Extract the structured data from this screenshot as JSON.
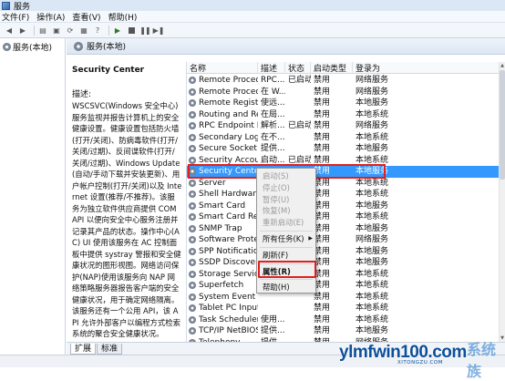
{
  "window": {
    "title": "服务"
  },
  "menubar": {
    "items": [
      "文件(F)",
      "操作(A)",
      "查看(V)",
      "帮助(H)"
    ]
  },
  "tree": {
    "root_label": "服务(本地)"
  },
  "main_header": {
    "title": "服务(本地)"
  },
  "description": {
    "service_name": "Security Center",
    "label": "描述:",
    "text": "WSCSVC(Windows 安全中心)服务监视并报告计算机上的安全健康设置。健康设置包括防火墙(打开/关闭)、防病毒软件(打开/关闭/过期)、反间谍软件(打开/关闭/过期)、Windows Update(自动/手动下载并安装更新)、用户帐户控制(打开/关闭)以及 Internet 设置(推荐/不推荐)。该服务为独立软件供应商提供 COM API 以便向安全中心服务注册并记录其产品的状态。操作中心(AC) UI 使用该服务在 AC 控制面板中提供 systray 警报和安全健康状况的图形视图。网络访问保护(NAP)使用该服务向 NAP 网络策略服务器报告客户端的安全健康状况，用于确定网络隔离。该服务还有一个公用 API，该 API 允许外部客户以编程方式检索系统的聚合安全健康状况。"
  },
  "list": {
    "columns": [
      "名称",
      "描述",
      "状态",
      "启动类型",
      "登录为"
    ],
    "rows": [
      {
        "name": "Remote Procedu...",
        "desc": "RPC...",
        "status": "已启动",
        "startup": "禁用",
        "logon": "网络服务"
      },
      {
        "name": "Remote Procedu...",
        "desc": "在 W...",
        "status": "",
        "startup": "禁用",
        "logon": "网络服务"
      },
      {
        "name": "Remote Registry",
        "desc": "使远...",
        "status": "",
        "startup": "禁用",
        "logon": "本地服务"
      },
      {
        "name": "Routing and Re...",
        "desc": "在局...",
        "status": "",
        "startup": "禁用",
        "logon": "本地系统"
      },
      {
        "name": "RPC Endpoint M...",
        "desc": "解析...",
        "status": "已启动",
        "startup": "禁用",
        "logon": "网络服务"
      },
      {
        "name": "Secondary Logon",
        "desc": "在不...",
        "status": "",
        "startup": "禁用",
        "logon": "本地系统"
      },
      {
        "name": "Secure Socket T...",
        "desc": "提供...",
        "status": "",
        "startup": "禁用",
        "logon": "本地服务"
      },
      {
        "name": "Security Account...",
        "desc": "启动...",
        "status": "已启动",
        "startup": "禁用",
        "logon": "本地系统"
      },
      {
        "name": "Security Center",
        "desc": "",
        "status": "",
        "startup": "禁用",
        "logon": "本地服务"
      },
      {
        "name": "Server",
        "desc": "",
        "status": "",
        "startup": "禁用",
        "logon": "本地系统"
      },
      {
        "name": "Shell Hardware ...",
        "desc": "",
        "status": "",
        "startup": "禁用",
        "logon": "本地系统"
      },
      {
        "name": "Smart Card",
        "desc": "",
        "status": "",
        "startup": "禁用",
        "logon": "本地服务"
      },
      {
        "name": "Smart Card Rem...",
        "desc": "",
        "status": "",
        "startup": "禁用",
        "logon": "本地系统"
      },
      {
        "name": "SNMP Trap",
        "desc": "",
        "status": "",
        "startup": "禁用",
        "logon": "本地服务"
      },
      {
        "name": "Software Protect...",
        "desc": "",
        "status": "",
        "startup": "禁用",
        "logon": "网络服务"
      },
      {
        "name": "SPP Notification ...",
        "desc": "",
        "status": "",
        "startup": "禁用",
        "logon": "本地服务"
      },
      {
        "name": "SSDP Discovery",
        "desc": "",
        "status": "",
        "startup": "禁用",
        "logon": "本地服务"
      },
      {
        "name": "Storage Service",
        "desc": "",
        "status": "",
        "startup": "禁用",
        "logon": "本地系统"
      },
      {
        "name": "Superfetch",
        "desc": "",
        "status": "",
        "startup": "禁用",
        "logon": "本地系统"
      },
      {
        "name": "System Event N...",
        "desc": "",
        "status": "",
        "startup": "禁用",
        "logon": "本地系统"
      },
      {
        "name": "Tablet PC Input ...",
        "desc": "",
        "status": "",
        "startup": "禁用",
        "logon": "本地系统"
      },
      {
        "name": "Task Scheduler",
        "desc": "使用...",
        "status": "",
        "startup": "禁用",
        "logon": "本地系统"
      },
      {
        "name": "TCP/IP NetBIOS ...",
        "desc": "提供...",
        "status": "",
        "startup": "禁用",
        "logon": "本地服务"
      },
      {
        "name": "Telephony",
        "desc": "提供...",
        "status": "",
        "startup": "禁用",
        "logon": "网络服务"
      }
    ],
    "selected_index": 8
  },
  "context_menu": {
    "start": "启动(S)",
    "stop": "停止(O)",
    "pause": "暂停(U)",
    "resume": "恢复(M)",
    "restart": "重新启动(E)",
    "all_tasks": "所有任务(K)",
    "refresh": "刷新(F)",
    "properties": "属性(R)",
    "help": "帮助(H)"
  },
  "tabs": [
    "扩展",
    "标准"
  ],
  "watermark": {
    "main": "ylmfwin100.com",
    "sub": "XITONGZU.COM",
    "cn": "系统族"
  },
  "colors": {
    "selection": "#3399ff",
    "highlight_box": "#e02020",
    "header_bg": "#dde7f3"
  },
  "icons": [
    "services-icon",
    "back-icon",
    "forward-icon",
    "start-service-icon",
    "stop-service-icon",
    "pause-service-icon",
    "restart-service-icon"
  ]
}
